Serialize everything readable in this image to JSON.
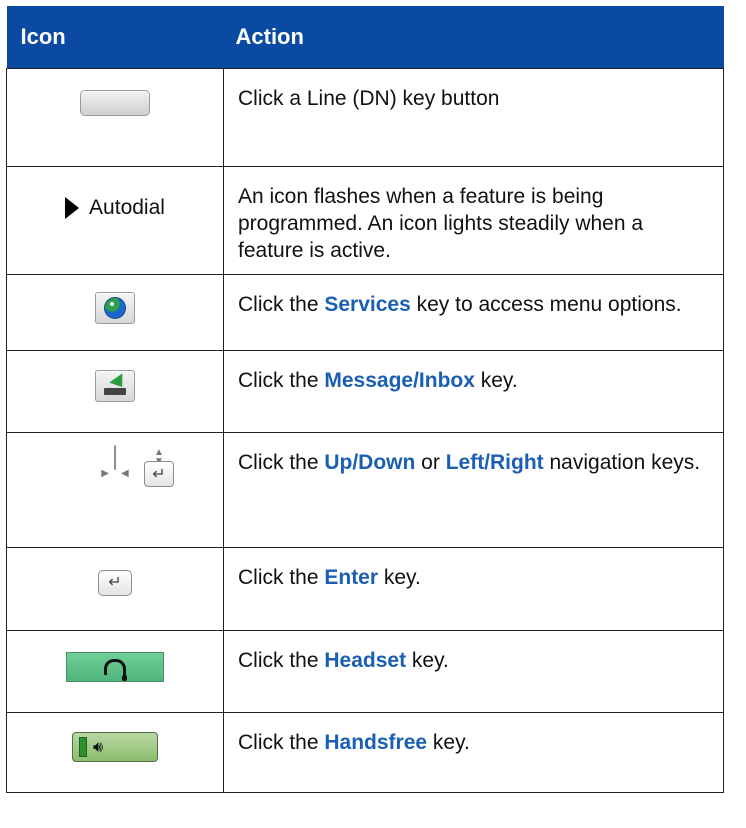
{
  "table": {
    "headers": {
      "icon": "Icon",
      "action": "Action"
    },
    "rows": [
      {
        "icon": {
          "type": "line-key-button"
        },
        "action": [
          {
            "text": "Click a Line (DN) key button",
            "bold": false
          }
        ]
      },
      {
        "icon": {
          "type": "autodial-indicator",
          "label": "Autodial"
        },
        "action": [
          {
            "text": "An icon flashes when a feature is being programmed. An icon lights steadily when a feature is active.",
            "bold": false
          }
        ]
      },
      {
        "icon": {
          "type": "services-key"
        },
        "action": [
          {
            "text": "Click the ",
            "bold": false
          },
          {
            "text": "Services",
            "bold": true
          },
          {
            "text": " key to access menu options.",
            "bold": false
          }
        ]
      },
      {
        "icon": {
          "type": "message-inbox-key"
        },
        "action": [
          {
            "text": "Click the ",
            "bold": false
          },
          {
            "text": "Message/Inbox",
            "bold": true
          },
          {
            "text": " key.",
            "bold": false
          }
        ]
      },
      {
        "icon": {
          "type": "navigation-pad"
        },
        "action": [
          {
            "text": "Click the ",
            "bold": false
          },
          {
            "text": "Up/Down",
            "bold": true
          },
          {
            "text": " or ",
            "bold": false
          },
          {
            "text": "Left/Right",
            "bold": true
          },
          {
            "text": " navigation keys.",
            "bold": false
          }
        ]
      },
      {
        "icon": {
          "type": "enter-key"
        },
        "action": [
          {
            "text": "Click the ",
            "bold": false
          },
          {
            "text": "Enter",
            "bold": true
          },
          {
            "text": " key.",
            "bold": false
          }
        ]
      },
      {
        "icon": {
          "type": "headset-key"
        },
        "action": [
          {
            "text": "Click the ",
            "bold": false
          },
          {
            "text": "Headset",
            "bold": true
          },
          {
            "text": " key.",
            "bold": false
          }
        ]
      },
      {
        "icon": {
          "type": "handsfree-key"
        },
        "action": [
          {
            "text": "Click the ",
            "bold": false
          },
          {
            "text": "Handsfree",
            "bold": true
          },
          {
            "text": " key.",
            "bold": false
          }
        ]
      }
    ]
  },
  "colors": {
    "header_background": "#0a4aa3",
    "highlight_text": "#1a5fb4",
    "headset_green": "#5bbf86",
    "handsfree_green": "#9fcb7f"
  }
}
